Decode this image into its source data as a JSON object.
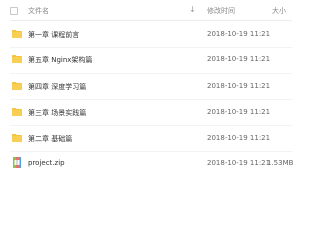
{
  "header": {
    "name_label": "文件名",
    "time_label": "修改时间",
    "size_label": "大小",
    "sort_indicator": "↓"
  },
  "files": [
    {
      "name": "第一章 课程前言",
      "modified": "2018-10-19 11:21",
      "size": "-",
      "type": "folder"
    },
    {
      "name": "第五章 Nginx架构篇",
      "modified": "2018-10-19 11:21",
      "size": "-",
      "type": "folder"
    },
    {
      "name": "第四章 深度学习篇",
      "modified": "2018-10-19 11:21",
      "size": "-",
      "type": "folder"
    },
    {
      "name": "第三章 场景实践篇",
      "modified": "2018-10-19 11:21",
      "size": "-",
      "type": "folder"
    },
    {
      "name": "第二章 基础篇",
      "modified": "2018-10-19 11:21",
      "size": "-",
      "type": "folder"
    },
    {
      "name": "project.zip",
      "modified": "2018-10-19 11:21",
      "size": "1.53MB",
      "type": "zip"
    }
  ],
  "colors": {
    "folder": "#f5c33b",
    "zip": "#8bc34a"
  }
}
